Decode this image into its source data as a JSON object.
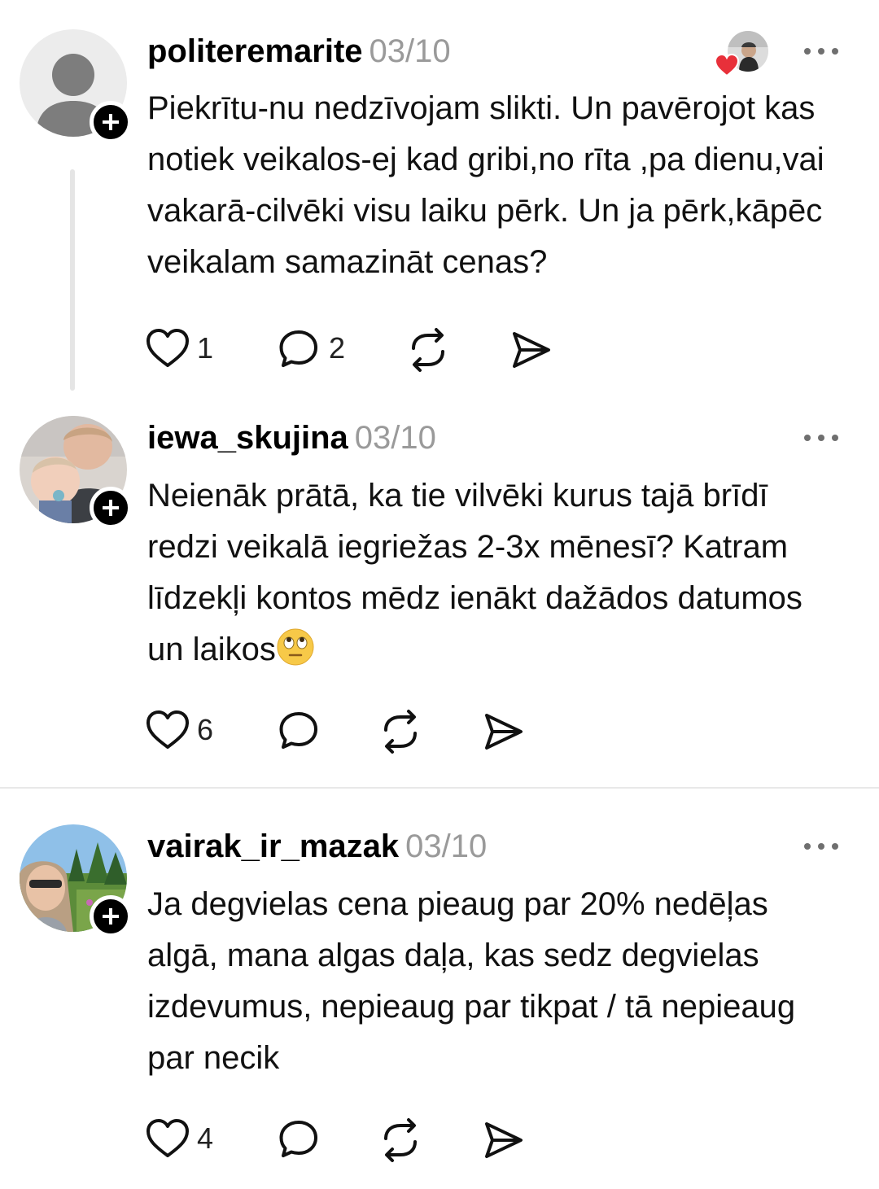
{
  "posts": [
    {
      "username": "politeremarite",
      "date": "03/10",
      "text": "Piekrītu-nu nedzīvojam slikti. Un pavērojot kas notiek veikalos-ej kad gribi,no rīta ,pa dienu,vai vakarā-cilvēki visu laiku pērk. Un ja pērk,kāpēc veikalam samazināt cenas?",
      "likes": "1",
      "replies": "2",
      "avatar": "default-person-icon"
    },
    {
      "username": "iewa_skujina",
      "date": "03/10",
      "text": "Neienāk prātā, ka tie vilvēki kurus tajā brīdī redzi veikalā iegriežas 2-3x mēnesī? Katram līdzekļi kontos mēdz ienākt dažādos datumos un laikos",
      "likes": "6",
      "avatar": "mother-and-baby-photo"
    },
    {
      "username": "vairak_ir_mazak",
      "date": "03/10",
      "text": "Ja degvielas cena pieaug par 20% nedēļas algā, mana algas daļa, kas sedz degvielas izdevumus, nepieaug par tikpat / tā nepieaug par necik",
      "likes": "4",
      "avatar": "woman-in-meadow-photo"
    }
  ],
  "colors": {
    "text": "#000000",
    "muted": "#9a9a9a",
    "badge": "#000000",
    "like_heart": "#e8303a"
  },
  "icons": [
    "heart-icon",
    "comment-icon",
    "repost-icon",
    "share-icon",
    "more-icon",
    "follow-plus-icon",
    "rolling-eyes-emoji"
  ]
}
